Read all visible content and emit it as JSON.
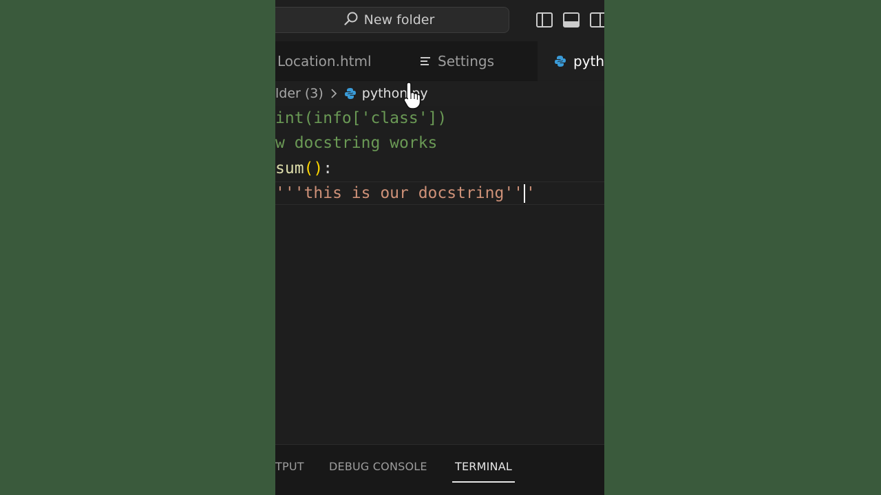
{
  "titlebar": {
    "search_label": "New folder",
    "icons": [
      "toggle-sidebar-icon",
      "toggle-panel-icon",
      "toggle-secondary-sidebar-icon"
    ]
  },
  "tabs": [
    {
      "label": "Location.html",
      "icon": "html-file-icon"
    },
    {
      "label": "Settings",
      "icon": "settings-list-icon"
    },
    {
      "label": "pytho",
      "icon": "python-icon",
      "active": true
    }
  ],
  "breadcrumb": {
    "folder": "lder (3)",
    "file": "python.py"
  },
  "code": {
    "line1": "int(info['class'])",
    "line2": "w docstring works",
    "line3_name": "sum",
    "line3_open": "(",
    "line3_close": ")",
    "line3_colon": ":",
    "line4_before": "'''this is our docstring''",
    "line4_after": "'"
  },
  "panel": {
    "tabs": [
      "TPUT",
      "DEBUG CONSOLE",
      "TERMINAL"
    ],
    "active": "TERMINAL"
  },
  "colors": {
    "accent": "#e7e7e7",
    "comment": "#6a9955",
    "string": "#ce9178",
    "function": "#dcdcaa",
    "bracket": "#ffd700",
    "python": "#3a9bd8"
  }
}
